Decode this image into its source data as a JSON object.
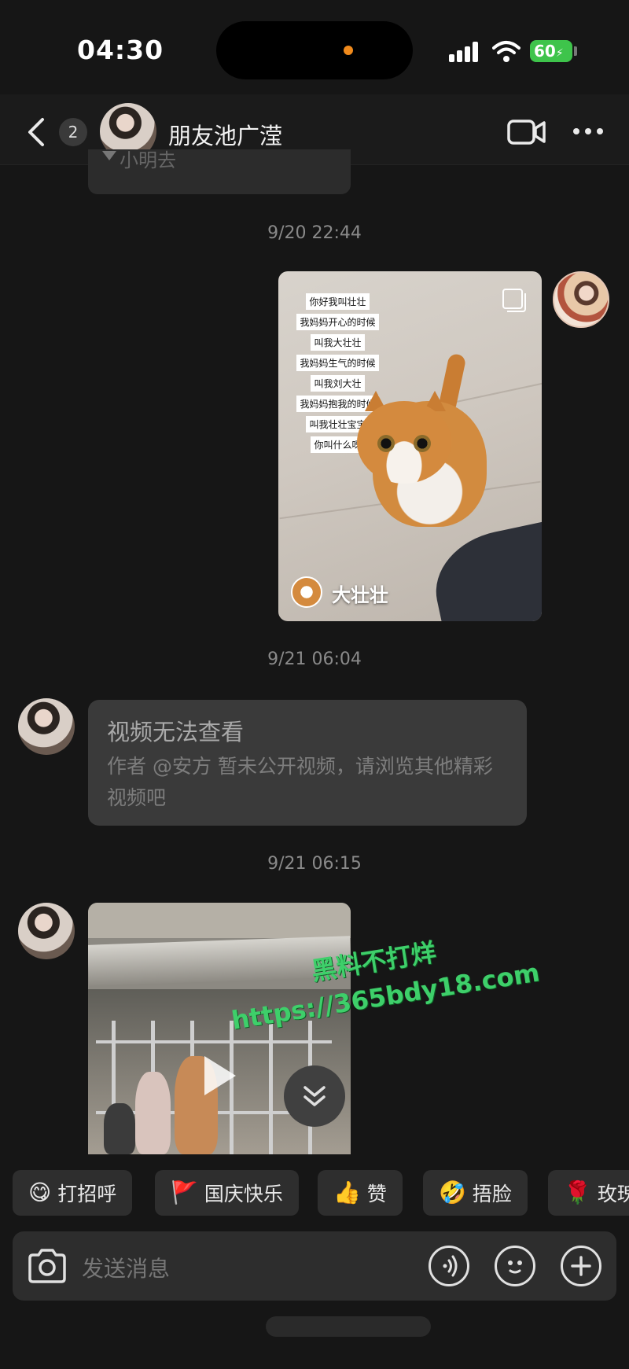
{
  "status_bar": {
    "time": "04:30",
    "battery": "60"
  },
  "header": {
    "unread_count": "2",
    "title": "朋友池广滢"
  },
  "messages": {
    "prev_bubble_text": "小明去",
    "ts1": "9/20 22:44",
    "video_card": {
      "captions": [
        "你好我叫壮壮",
        "我妈妈开心的时候",
        "叫我大壮壮",
        "我妈妈生气的时候",
        "叫我刘大壮",
        "我妈妈抱我的时候",
        "叫我壮壮宝宝",
        "你叫什么呀"
      ],
      "author": "大壮壮"
    },
    "ts2": "9/21 06:04",
    "unavailable": {
      "title": "视频无法查看",
      "desc": "作者 @安方 暂未公开视频，请浏览其他精彩视频吧"
    },
    "ts3": "9/21 06:15"
  },
  "watermark": {
    "line1": "黑料不打烊",
    "line2": "https://365bdy18.com"
  },
  "quick_replies": [
    {
      "emoji": "😋",
      "label": "打招呼"
    },
    {
      "emoji": "🚩",
      "label": "国庆快乐"
    },
    {
      "emoji": "👍",
      "label": "赞"
    },
    {
      "emoji": "🤣",
      "label": "捂脸"
    },
    {
      "emoji": "🌹",
      "label": "玫瑰"
    }
  ],
  "input": {
    "placeholder": "发送消息"
  },
  "icons": [
    "back-icon",
    "video-call-icon",
    "more-icon",
    "camera-icon",
    "voice-icon",
    "emoji-icon",
    "plus-icon",
    "copy-icon",
    "play-icon",
    "scroll-down-icon",
    "signal-icon",
    "wifi-icon"
  ]
}
